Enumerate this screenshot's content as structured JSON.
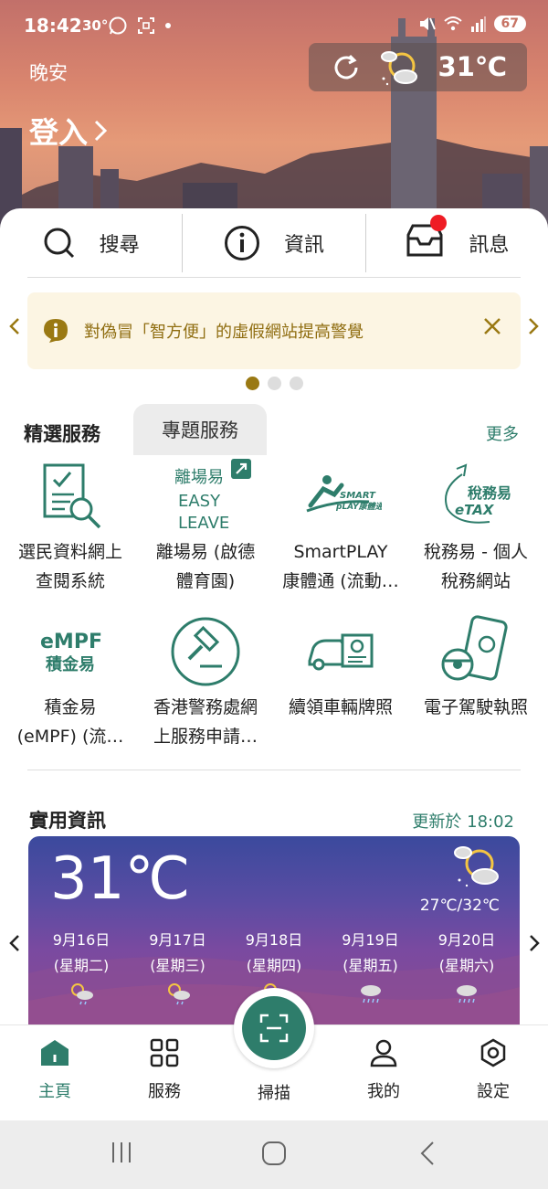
{
  "status_bar": {
    "time": "18:42",
    "temp": "30°",
    "battery": "67"
  },
  "header": {
    "greeting": "晚安",
    "login": "登入",
    "weather_temp": "31℃"
  },
  "quick_actions": [
    {
      "label": "搜尋",
      "icon": "search-icon"
    },
    {
      "label": "資訊",
      "icon": "info-icon"
    },
    {
      "label": "訊息",
      "icon": "inbox-icon"
    }
  ],
  "notice": {
    "text": "對偽冒「智方便」的虛假網站提高警覺"
  },
  "tabs": {
    "featured": "精選服務",
    "topic": "專題服務",
    "more": "更多"
  },
  "services": [
    {
      "label": "選民資料網上\n查閱系統",
      "icon": "voter-document-search-icon"
    },
    {
      "label": "離場易 (啟德\n體育園)",
      "icon": "easy-leave-logo-icon"
    },
    {
      "label": "SmartPLAY\n康體通 (流動…",
      "icon": "smartplay-logo-icon"
    },
    {
      "label": "稅務易 - 個人\n稅務網站",
      "icon": "etax-logo-icon"
    },
    {
      "label": "積金易\n(eMPF) (流…",
      "icon": "empf-logo-icon"
    },
    {
      "label": "香港警務處網\n上服務申請…",
      "icon": "police-gavel-icon"
    },
    {
      "label": "續領車輛牌照",
      "icon": "vehicle-licence-icon"
    },
    {
      "label": "電子駕駛執照",
      "icon": "e-driving-licence-icon"
    }
  ],
  "logos": {
    "easy_leave": "離場易",
    "easy_leave_en": "EASY\nLEAVE",
    "smartplay": "SMART PLAY 康體通",
    "etax": "稅務易",
    "etax_en": "eTAX",
    "empf": "eMPF",
    "empf_cn": "積金易"
  },
  "info": {
    "title": "實用資訊",
    "updated": "更新於 18:02"
  },
  "forecast": {
    "current_temp": "31℃",
    "range": "27℃/32℃",
    "days": [
      {
        "date": "9月16日",
        "weekday": "(星期二)",
        "icon": "sun-cloud-rain-icon"
      },
      {
        "date": "9月17日",
        "weekday": "(星期三)",
        "icon": "sun-cloud-rain-icon"
      },
      {
        "date": "9月18日",
        "weekday": "(星期四)",
        "icon": "sun-cloud-rain-icon"
      },
      {
        "date": "9月19日",
        "weekday": "(星期五)",
        "icon": "cloud-rain-icon"
      },
      {
        "date": "9月20日",
        "weekday": "(星期六)",
        "icon": "cloud-rain-icon"
      }
    ]
  },
  "bottom_nav": [
    {
      "label": "主頁",
      "icon": "home-icon",
      "active": true
    },
    {
      "label": "服務",
      "icon": "grid-icon",
      "active": false
    },
    {
      "label": "掃描",
      "icon": "scan-icon",
      "active": false
    },
    {
      "label": "我的",
      "icon": "person-icon",
      "active": false
    },
    {
      "label": "設定",
      "icon": "settings-icon",
      "active": false
    }
  ],
  "colors": {
    "brand": "#2e7d6b",
    "notice_text": "#8f6d10",
    "notice_bg": "#fcf5e3",
    "badge": "#ef1c24"
  }
}
